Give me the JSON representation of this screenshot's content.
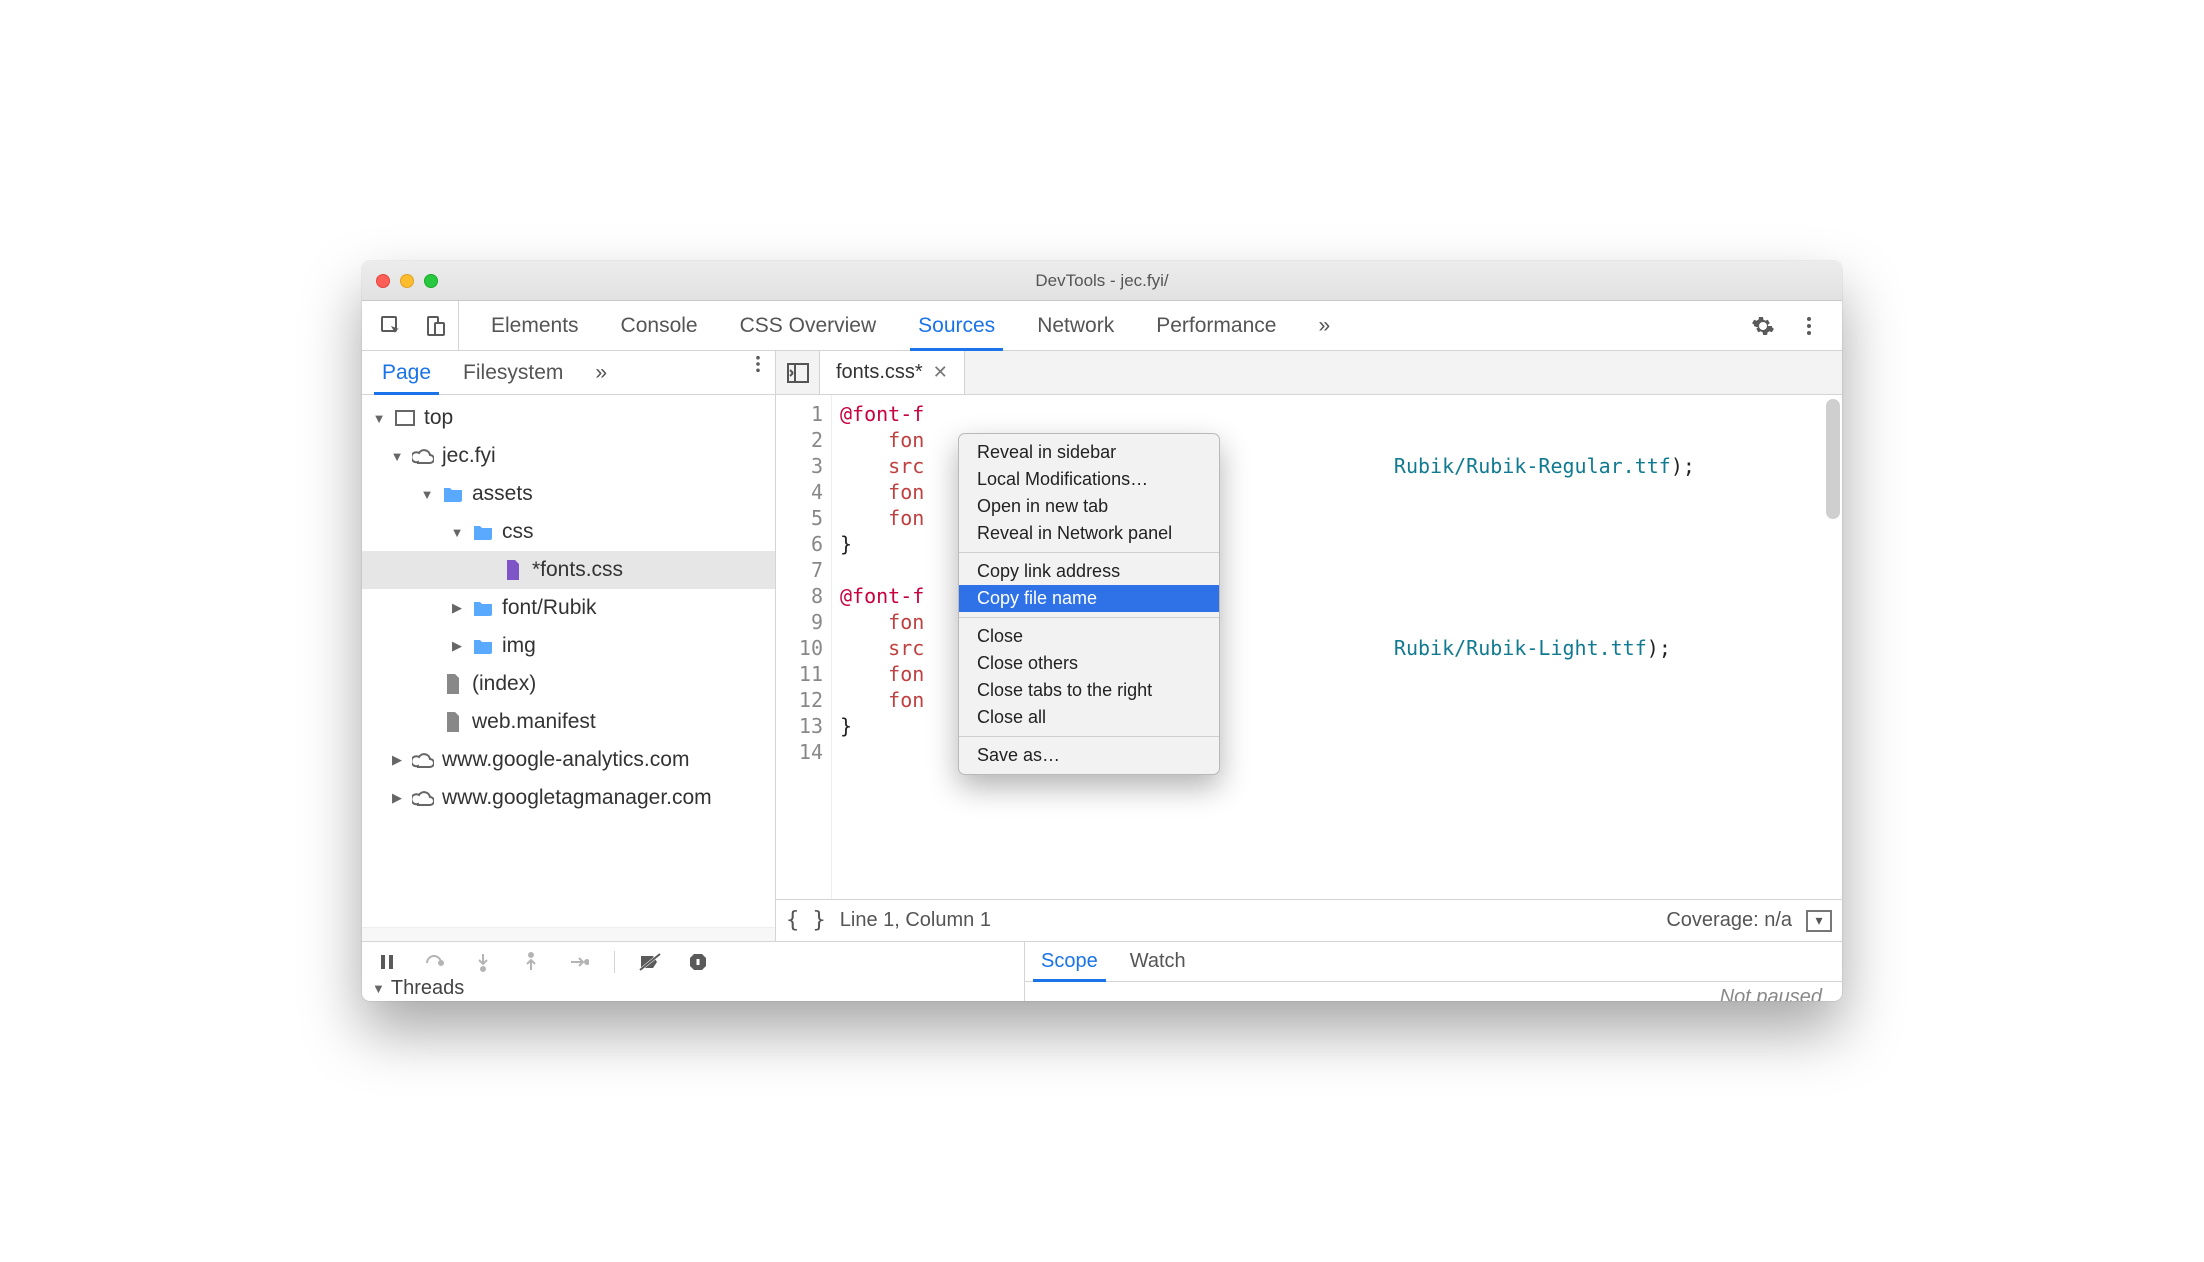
{
  "window": {
    "title": "DevTools - jec.fyi/"
  },
  "top_tabs": {
    "items": [
      "Elements",
      "Console",
      "CSS Overview",
      "Sources",
      "Network",
      "Performance"
    ],
    "active": "Sources",
    "more": "»"
  },
  "sidebar": {
    "tabs": [
      "Page",
      "Filesystem"
    ],
    "active": "Page",
    "more": "»",
    "tree": {
      "top": "top",
      "domain": "jec.fyi",
      "assets": "assets",
      "css": "css",
      "fonts_css": "*fonts.css",
      "font_rubik": "font/Rubik",
      "img": "img",
      "index": "(index)",
      "manifest": "web.manifest",
      "ga": "www.google-analytics.com",
      "gtm": "www.googletagmanager.com"
    }
  },
  "editor": {
    "file_tab": "fonts.css*",
    "line_numbers": [
      "1",
      "2",
      "3",
      "4",
      "5",
      "6",
      "7",
      "8",
      "9",
      "10",
      "11",
      "12",
      "13",
      "14"
    ],
    "code_lines": [
      {
        "t": "@font-f",
        "cls": "tok-kw"
      },
      {
        "t": "    fon",
        "cls": "tok-prop"
      },
      {
        "t1": "    src",
        "cls1": "tok-prop",
        "t2": "Rubik/Rubik-Regular.ttf",
        "cls2": "tok-url",
        "t3": ");"
      },
      {
        "t": "    fon",
        "cls": "tok-prop"
      },
      {
        "t": "    fon",
        "cls": "tok-prop"
      },
      {
        "t": "}",
        "cls": ""
      },
      {
        "t": "",
        "cls": ""
      },
      {
        "t": "@font-f",
        "cls": "tok-kw"
      },
      {
        "t": "    fon",
        "cls": "tok-prop"
      },
      {
        "t1": "    src",
        "cls1": "tok-prop",
        "t2": "Rubik/Rubik-Light.ttf",
        "cls2": "tok-url",
        "t3": ");"
      },
      {
        "t": "    fon",
        "cls": "tok-prop"
      },
      {
        "t": "    fon",
        "cls": "tok-prop"
      },
      {
        "t": "}",
        "cls": ""
      },
      {
        "t": "",
        "cls": ""
      }
    ],
    "status": {
      "braces": "{ }",
      "pos": "Line 1, Column 1",
      "coverage": "Coverage: n/a"
    }
  },
  "debugger": {
    "threads_label": "Threads",
    "tabs": [
      "Scope",
      "Watch"
    ],
    "active": "Scope",
    "not_paused": "Not paused"
  },
  "context_menu": {
    "group1": [
      "Reveal in sidebar",
      "Local Modifications…",
      "Open in new tab",
      "Reveal in Network panel"
    ],
    "group2": [
      "Copy link address",
      "Copy file name"
    ],
    "group3": [
      "Close",
      "Close others",
      "Close tabs to the right",
      "Close all"
    ],
    "group4": [
      "Save as…"
    ],
    "highlight": "Copy file name"
  }
}
